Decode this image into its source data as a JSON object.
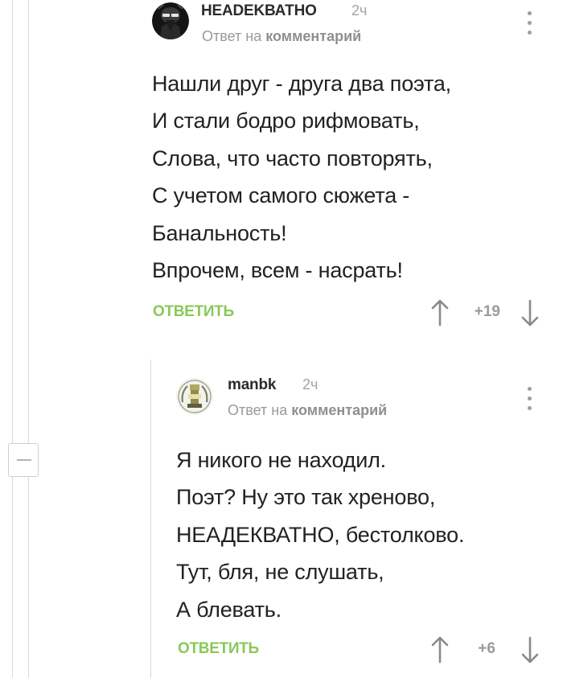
{
  "comments": [
    {
      "author": "НЕАDEKВАТНО",
      "time": "2ч",
      "reply_prefix": "Ответ на",
      "reply_target": "комментарий",
      "lines": [
        "Нашли друг - друга два поэта,",
        "И стали бодро рифмовать,",
        "Слова, что часто повторять,",
        "С учетом самого сюжета -",
        "Банальность!",
        "Впрочем, всем - насрать!"
      ],
      "reply_label": "ОТВЕТИТЬ",
      "rating": "+19"
    },
    {
      "author": "manbk",
      "time": "2ч",
      "reply_prefix": "Ответ на",
      "reply_target": "комментарий",
      "lines": [
        "Я никого не находил.",
        "Поэт? Ну это так хреново,",
        "НЕАДЕКВАТНО, бестолково.",
        "Тут, бля, не слушать,",
        "А блевать."
      ],
      "reply_label": "ОТВЕТИТЬ",
      "rating": "+6"
    }
  ],
  "icons": {
    "collapse": "minus-icon",
    "more": "more-vertical-icon",
    "vote_up": "arrow-up-icon",
    "vote_down": "arrow-down-icon"
  },
  "colors": {
    "reply_action": "#8ac858",
    "muted_text": "#9a9a9a",
    "thread_line": "#d9d9d9"
  }
}
